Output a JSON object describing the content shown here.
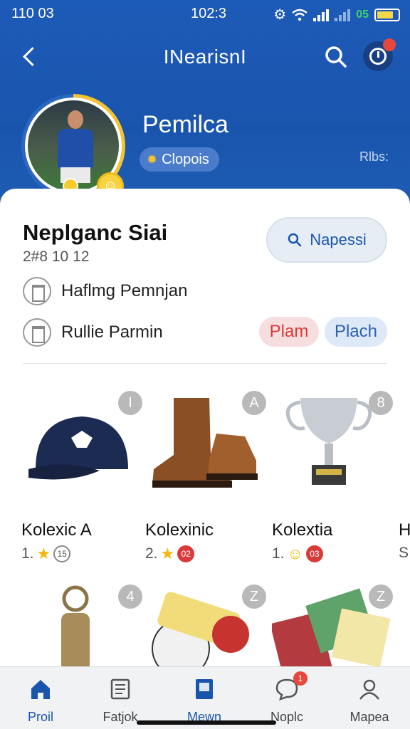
{
  "status_bar": {
    "left": "110 03",
    "time": "102:3",
    "network": "05"
  },
  "header": {
    "title": "INearisnI",
    "profile_name": "Pemilca",
    "chip_label": "Clopois",
    "side_text": "Rlbs:"
  },
  "card": {
    "title": "Neplganc Siai",
    "subtitle": "2#8 10 12",
    "search_button": "Napessi",
    "rows": [
      {
        "label": "Haflmg Pemnjan"
      },
      {
        "label": "Rullie Parmin"
      }
    ],
    "tags": [
      {
        "label": "Plam",
        "color": "#d93a3a"
      },
      {
        "label": "Plach",
        "color": "#2d62b3"
      }
    ]
  },
  "items": [
    {
      "num": "I",
      "name": "Kolexic A",
      "rank": "1.",
      "badge": "15",
      "badge_style": "outline",
      "icon": "cap-icon"
    },
    {
      "num": "A",
      "name": "Kolexinic",
      "rank": "2.",
      "badge": "02",
      "badge_style": "red",
      "icon": "boots-icon"
    },
    {
      "num": "8",
      "name": "Kolextia",
      "rank": "1.",
      "badge": "03",
      "badge_style": "red",
      "icon": "trophy-icon"
    },
    {
      "name": "H",
      "rank": "S"
    },
    {
      "num": "4",
      "icon": "keychain-icon"
    },
    {
      "num": "Z",
      "icon": "scarf-ball-icon"
    },
    {
      "num": "Z",
      "icon": "cards-icon"
    }
  ],
  "tabs": [
    {
      "label": "Proil",
      "icon": "home-icon",
      "active": true
    },
    {
      "label": "Fatjok",
      "icon": "news-icon"
    },
    {
      "label": "Mewn",
      "icon": "book-icon",
      "active": true
    },
    {
      "label": "Noplc",
      "icon": "chat-icon",
      "badge": "1"
    },
    {
      "label": "Mapea",
      "icon": "user-icon"
    }
  ],
  "colors": {
    "primary": "#1a55ad",
    "accent_yellow": "#f3c431",
    "alert_red": "#e8473d"
  }
}
